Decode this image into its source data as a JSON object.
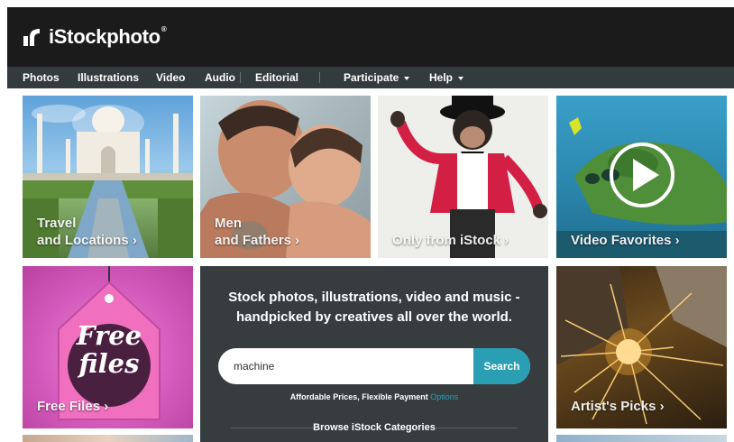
{
  "header": {
    "logo_text": "iStockphoto",
    "logo_reg": "®",
    "background": "#1b1b1b"
  },
  "nav": {
    "items": [
      {
        "label": "Photos",
        "dropdown": false
      },
      {
        "label": "Illustrations",
        "dropdown": false
      },
      {
        "label": "Video",
        "dropdown": false
      },
      {
        "label": "Audio",
        "dropdown": false
      },
      {
        "label": "Editorial",
        "dropdown": false
      },
      {
        "label": "Participate",
        "dropdown": true
      },
      {
        "label": "Help",
        "dropdown": true
      }
    ],
    "background": "#343b3d"
  },
  "tiles": [
    {
      "line1": "Travel",
      "line2": "and Locations ›"
    },
    {
      "line1": "Men",
      "line2": "and Fathers ›"
    },
    {
      "line1": "",
      "line2": "Only from iStock ›"
    },
    {
      "line1": "",
      "line2": "Video Favorites ›"
    },
    {
      "line1": "",
      "line2": "Free Files ›",
      "badge_line1": "Free",
      "badge_line2": "files"
    },
    {
      "line1": "",
      "line2": "Artist's Picks ›"
    }
  ],
  "promo": {
    "headline_line1": "Stock photos, illustrations, video and music -",
    "headline_line2": "handpicked by creatives all over the world.",
    "search_value": "machine",
    "search_button": "Search",
    "afford_text": "Affordable Prices, Flexible Payment",
    "afford_link": "Options",
    "browse": "Browse iStock Categories"
  },
  "colors": {
    "accent": "#2a9fb3",
    "promo_bg": "#373d3f"
  }
}
